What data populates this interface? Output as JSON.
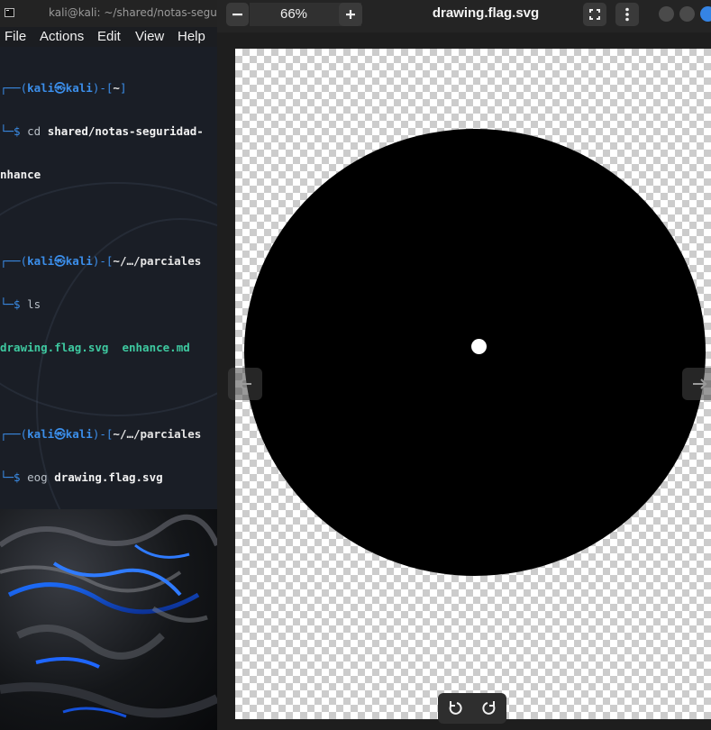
{
  "terminal": {
    "title": "kali@kali: ~/shared/notas-seguridad",
    "menu": [
      "File",
      "Actions",
      "Edit",
      "View",
      "Help"
    ],
    "lines": [
      {
        "prefix": "┌──(",
        "user": "kali",
        "at": "㉿",
        "host": "kali",
        "mid": ")-[",
        "path": "~",
        "end": "]"
      },
      {
        "prompt": "└─$ ",
        "cmd": "cd",
        "args": " shared/notas-seguridad-"
      },
      {
        "wrap": "nhance"
      },
      {
        "blank": ""
      },
      {
        "prefix": "┌──(",
        "user": "kali",
        "at": "㉿",
        "host": "kali",
        "mid": ")-[",
        "path": "~/…/parciales"
      },
      {
        "prompt": "└─$ ",
        "cmd": "ls"
      },
      {
        "files": [
          "drawing.flag.svg",
          "enhance.md"
        ]
      },
      {
        "blank": ""
      },
      {
        "prefix": "┌──(",
        "user": "kali",
        "at": "㉿",
        "host": "kali",
        "mid": ")-[",
        "path": "~/…/parciales"
      },
      {
        "prompt": "└─$ ",
        "cmd": "eog",
        "args": " drawing.flag.svg"
      }
    ]
  },
  "viewer": {
    "zoom": "66%",
    "title": "drawing.flag.svg",
    "icons": {
      "zoom_out": "minus-icon",
      "zoom_in": "plus-icon",
      "zoom_dropdown": "arrow-down-icon",
      "fullscreen": "fullscreen-icon",
      "menu": "kebab-menu-icon",
      "prev": "arrow-left-icon",
      "next": "arrow-right-icon",
      "rotate_left": "rotate-left-icon",
      "rotate_right": "rotate-right-icon"
    },
    "colors": {
      "accent": "#3584e4",
      "circle": "#000000",
      "dot": "#ffffff"
    }
  }
}
